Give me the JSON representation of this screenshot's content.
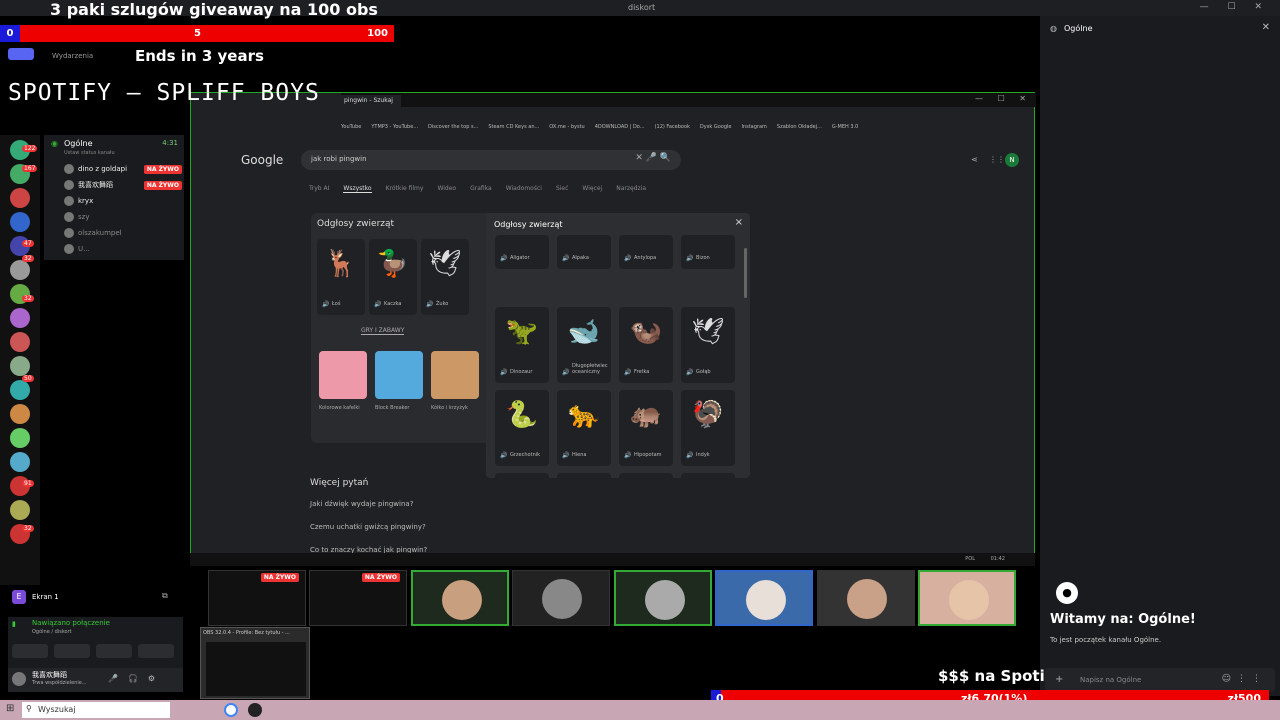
{
  "overlay": {
    "title": "3 paki szlugów giveaway na 100 obs",
    "progress_start": "0",
    "progress_current": "5",
    "progress_goal": "100",
    "ends": "Ends in 3 years",
    "spotify": "SPOTIFY – SPLIFF BOYS",
    "events_label": "Wydarzenia"
  },
  "topbar": {
    "title": "diskort"
  },
  "sidebar_servers": [
    "avatar-1",
    "avatar-2",
    "avatar-3",
    "avatar-4",
    "avatar-5",
    "avatar-6",
    "avatar-7",
    "avatar-8"
  ],
  "server_badges": [
    "122",
    "167",
    "47",
    "32",
    "32",
    "50",
    "91",
    "32"
  ],
  "voice_channel": {
    "name": "Ogólne",
    "time": "4:31",
    "sub": "Ustaw status kanału",
    "members": [
      {
        "name": "dino z goldapi",
        "live": "NA ŻYWO"
      },
      {
        "name": "我喜欢舞蹈",
        "live": "NA ŻYWO"
      },
      {
        "name": "kryx",
        "live": ""
      },
      {
        "name": "szy",
        "live": ""
      },
      {
        "name": "olszakumpel",
        "live": ""
      },
      {
        "name": "U...",
        "live": ""
      }
    ]
  },
  "browser": {
    "tab_title": "pingwin - Szukaj",
    "bookmarks": [
      "YouTube",
      "YTMP3 - YouTube...",
      "Discover the top s...",
      "Steam CD Keys an...",
      "OX.me - bystu",
      "4DOWNLOAD | Do...",
      "(12) Facebook",
      "Dysk Google",
      "Instagram",
      "Szablon Okładej...",
      "G-MEH 3.0"
    ],
    "google_logo": "Google",
    "search_text": "jak robi pingwin",
    "filters": [
      "Tryb AI",
      "Wszystko",
      "Krótkie filmy",
      "Wideo",
      "Grafika",
      "Wiadomości",
      "Sieć",
      "Więcej",
      "Narzędzia"
    ],
    "active_filter": "Wszystko",
    "card_title": "Odgłosy zwierząt",
    "card_animals": [
      "Łoś",
      "Kaczka",
      "Żuko"
    ],
    "games_label": "GRY I ZABAWY",
    "games": [
      "Kolorowe kafelki",
      "Block Breaker",
      "Kółko i krzyżyk"
    ],
    "more_questions": "Więcej pytań",
    "questions": [
      "Jaki dźwięk wydaje pingwina?",
      "Czemu uchatki gwiżcą pingwiny?",
      "Co to znaczy kochać jak pingwin?"
    ]
  },
  "modal": {
    "title": "Odgłosy zwierząt",
    "close": "×",
    "rows": [
      [
        {
          "label": "Aligator",
          "emoji": ""
        },
        {
          "label": "Alpaka",
          "emoji": ""
        },
        {
          "label": "Antylopa",
          "emoji": ""
        },
        {
          "label": "Bizon",
          "emoji": ""
        }
      ],
      [
        {
          "label": "Dinozaur",
          "emoji": "🦖"
        },
        {
          "label": "Długopłetwiec oceaniczny",
          "emoji": "🐋"
        },
        {
          "label": "Fretka",
          "emoji": "🦦"
        },
        {
          "label": "Gołąb",
          "emoji": "🕊"
        }
      ],
      [
        {
          "label": "Grzechotnik",
          "emoji": "🐍"
        },
        {
          "label": "Hiena",
          "emoji": "🐆"
        },
        {
          "label": "Hipopotam",
          "emoji": "🦛"
        },
        {
          "label": "Indyk",
          "emoji": "🦃"
        }
      ],
      [
        {
          "label": "",
          "emoji": "🐃"
        },
        {
          "label": "",
          "emoji": "🐆"
        },
        {
          "label": "",
          "emoji": "🦔"
        },
        {
          "label": "",
          "emoji": "🦆"
        }
      ]
    ]
  },
  "taskbar_inner": {
    "lang": "POL",
    "time": "01:42"
  },
  "streams": [
    {
      "live": "NA ŻYWO"
    },
    {
      "live": "NA ŻYWO"
    }
  ],
  "screen_share": {
    "label": "Ekran 1"
  },
  "connection": {
    "status": "Nawiązano połączenie",
    "detail": "Ogólne / diskort"
  },
  "user": {
    "name": "我喜欢舞蹈",
    "status": "Trwa współdzielenie..."
  },
  "obs": {
    "title": "OBS 32.0.4 - Profile: Bez tytułu - ..."
  },
  "right_panel": {
    "channel": "Ogólne",
    "welcome": "Witamy na: Ogólne!",
    "welcome_sub": "To jest początek kanału Ogólne.",
    "message_placeholder": "Napisz na Ogólne"
  },
  "donation": {
    "title": "$$$ na Spoti",
    "start": "0",
    "current": "zł6.70(1%)",
    "goal": "zł500"
  },
  "windows": {
    "search_placeholder": "Wyszukaj"
  },
  "colors": {
    "accent_red": "#ee0000",
    "accent_blue": "#1a1ad8",
    "live_red": "#e33333",
    "green_border": "#33aa33"
  }
}
